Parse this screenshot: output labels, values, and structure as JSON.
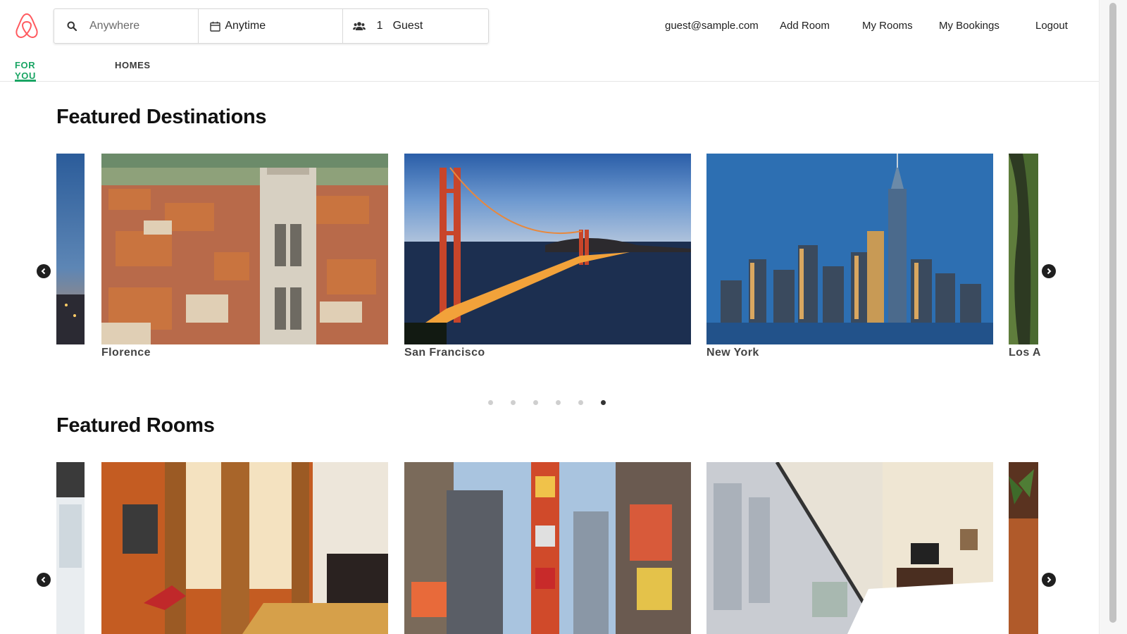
{
  "brand": {
    "accent": "#ff5a5f",
    "tab_accent": "#1aa564"
  },
  "search": {
    "where_placeholder": "Anywhere",
    "when_label": "Anytime",
    "guest_count": "1",
    "guest_label": "Guest"
  },
  "nav": {
    "email": "guest@sample.com",
    "add_room": "Add Room",
    "my_rooms": "My Rooms",
    "my_bookings": "My Bookings",
    "logout": "Logout"
  },
  "tabs": [
    {
      "label": "FOR YOU",
      "active": true
    },
    {
      "label": "HOMES",
      "active": false
    }
  ],
  "featured_destinations": {
    "title": "Featured Destinations",
    "cards": [
      {
        "name": "Florence"
      },
      {
        "name": "San Francisco"
      },
      {
        "name": "New York"
      },
      {
        "name": "Los A"
      }
    ],
    "dots": {
      "count": 6,
      "active_index": 5
    }
  },
  "featured_rooms": {
    "title": "Featured Rooms"
  }
}
